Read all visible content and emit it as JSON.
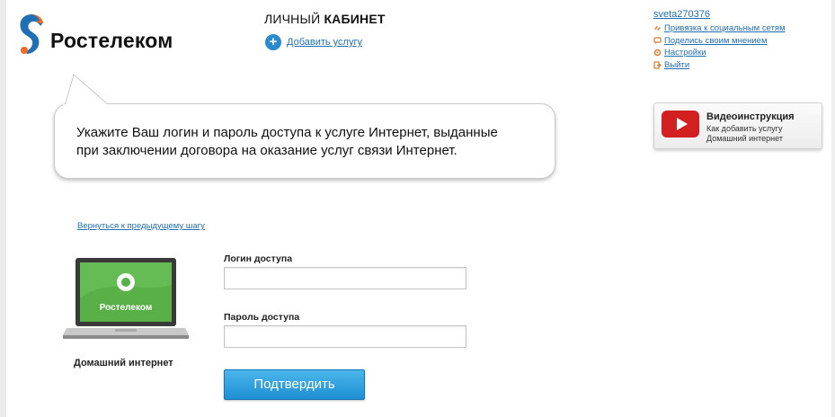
{
  "brand": {
    "name": "Ростелеком",
    "colors": {
      "orange": "#f26a21",
      "blue": "#1f6fb5",
      "laptop_green": "#58b047"
    }
  },
  "header": {
    "title_regular": "ЛИЧНЫЙ ",
    "title_bold": "КАБИНЕТ",
    "add_service": {
      "icon": "plus-circle-icon",
      "label": "Добавить услугу"
    }
  },
  "user_menu": {
    "username": "sveta270376",
    "items": [
      {
        "icon": "social-link-icon",
        "label": "Привязка к социальным сетям"
      },
      {
        "icon": "feedback-icon",
        "label": "Поделись своим мнением"
      },
      {
        "icon": "settings-icon",
        "label": "Настройки"
      },
      {
        "icon": "logout-icon",
        "label": "Выйти"
      }
    ]
  },
  "instruction": {
    "line1": "Укажите Ваш логин и пароль доступа к услуге Интернет, выданные",
    "line2": "при заключении договора на оказание услуг связи Интернет."
  },
  "video": {
    "icon": "youtube-play-icon",
    "title": "Видеоинструкция",
    "line1": "Как добавить услугу",
    "line2": "Домашний интернет"
  },
  "back_link": "Вернуться к предыдущему шагу",
  "product": {
    "screen_logo": "Ростелеком",
    "caption": "Домашний интернет"
  },
  "form": {
    "login_label": "Логин доступа",
    "login_value": "",
    "password_label": "Пароль доступа",
    "password_value": "",
    "submit": "Подтвердить"
  }
}
